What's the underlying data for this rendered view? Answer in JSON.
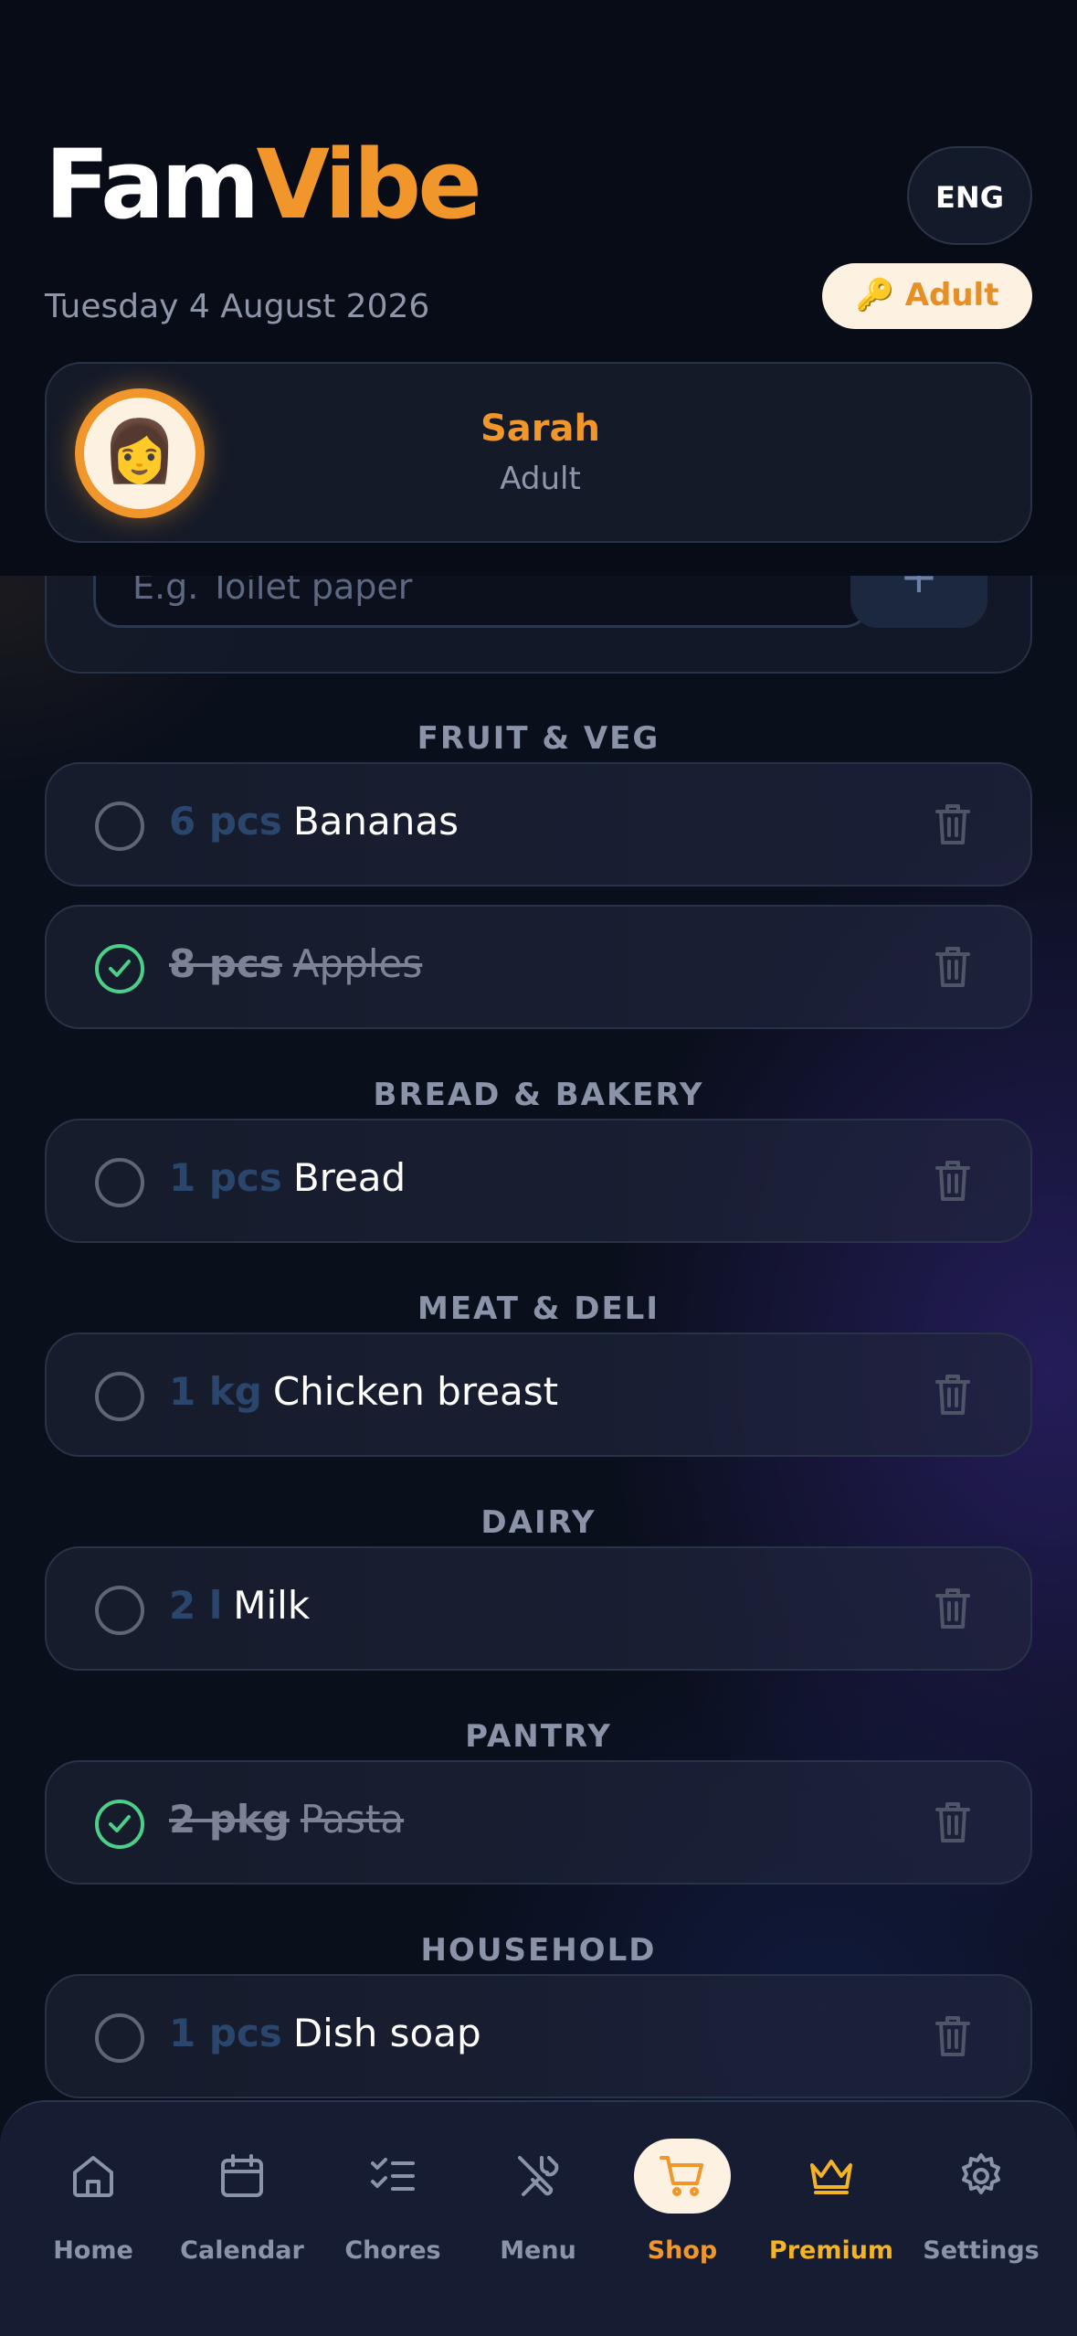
{
  "header": {
    "logo_part1": "Fam",
    "logo_part2": "Vibe",
    "language": "ENG",
    "date": "Tuesday 4 August 2026",
    "role_badge": "🔑 Adult"
  },
  "profile": {
    "name": "Sarah",
    "role": "Adult",
    "avatar_emoji": "👩"
  },
  "add_item": {
    "placeholder": "E.g. Toilet paper",
    "add_label": "+"
  },
  "sections": [
    {
      "title": "FRUIT & VEG",
      "items": [
        {
          "qty": "6 pcs",
          "name": "Bananas",
          "done": false
        },
        {
          "qty": "8 pcs",
          "name": "Apples",
          "done": true
        }
      ]
    },
    {
      "title": "BREAD & BAKERY",
      "items": [
        {
          "qty": "1 pcs",
          "name": "Bread",
          "done": false
        }
      ]
    },
    {
      "title": "MEAT & DELI",
      "items": [
        {
          "qty": "1 kg",
          "name": "Chicken breast",
          "done": false
        }
      ]
    },
    {
      "title": "DAIRY",
      "items": [
        {
          "qty": "2 l",
          "name": "Milk",
          "done": false
        }
      ]
    },
    {
      "title": "PANTRY",
      "items": [
        {
          "qty": "2 pkg",
          "name": "Pasta",
          "done": true
        }
      ]
    },
    {
      "title": "HOUSEHOLD",
      "items": [
        {
          "qty": "1 pcs",
          "name": "Dish soap",
          "done": false
        }
      ]
    }
  ],
  "nav": [
    {
      "label": "Home",
      "icon": "home-icon"
    },
    {
      "label": "Calendar",
      "icon": "calendar-icon"
    },
    {
      "label": "Chores",
      "icon": "checklist-icon"
    },
    {
      "label": "Menu",
      "icon": "utensils-icon"
    },
    {
      "label": "Shop",
      "icon": "cart-icon",
      "active": true
    },
    {
      "label": "Premium",
      "icon": "crown-icon"
    },
    {
      "label": "Settings",
      "icon": "gear-icon"
    }
  ],
  "colors": {
    "accent": "#f0962b",
    "premium": "#f3b324",
    "done_check": "#4bd08a",
    "background": "#0a0f1c"
  }
}
